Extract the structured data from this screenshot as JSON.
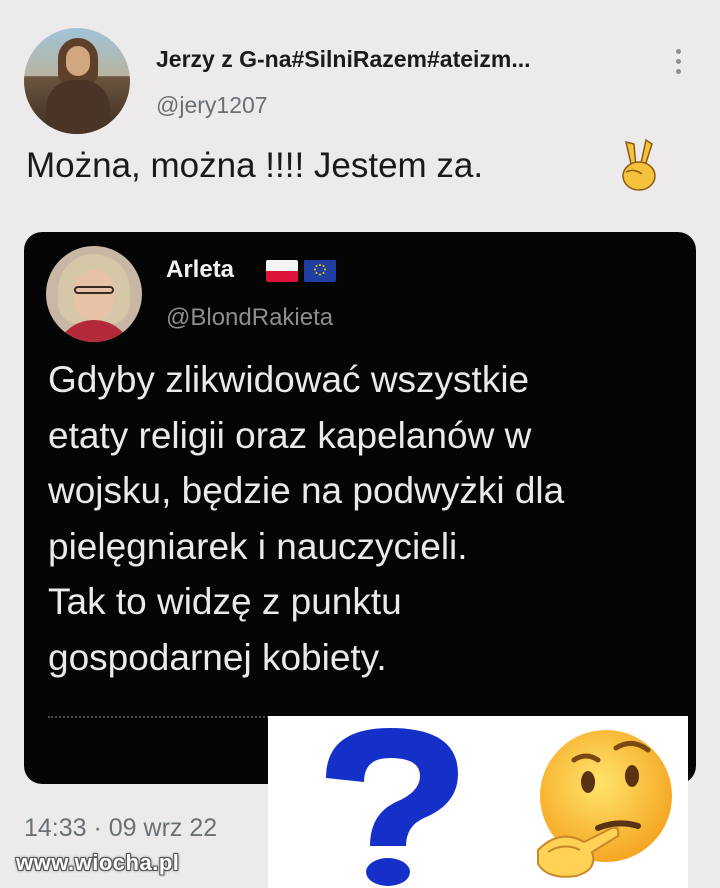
{
  "tweet": {
    "author_name": "Jerzy z G-na#SilniRazem#ateizm...",
    "author_handle": "@jery1207",
    "text": "Można, można !!!! Jestem za.",
    "emoji": "victory-hand",
    "timestamp": "14:33 · 09 wrz 22"
  },
  "quoted_tweet": {
    "author_name": "Arleta",
    "author_flags": [
      "poland-flag",
      "eu-flag"
    ],
    "author_handle": "@BlondRakieta",
    "text": "Gdyby zlikwidować wszystkie\netaty religii oraz kapelanów w\nwojsku, będzie na podwyżki dla\npielęgniarek i nauczycieli.\nTak to widzę z punktu\ngospodarnej kobiety."
  },
  "overlay": {
    "question_mark_color": "#1530c8",
    "emoji": "thinking-face"
  },
  "watermark": "www.wiocha.pl",
  "colors": {
    "background": "#eceaeb",
    "quote_background": "#050505",
    "secondary_text": "#6a6f74"
  }
}
